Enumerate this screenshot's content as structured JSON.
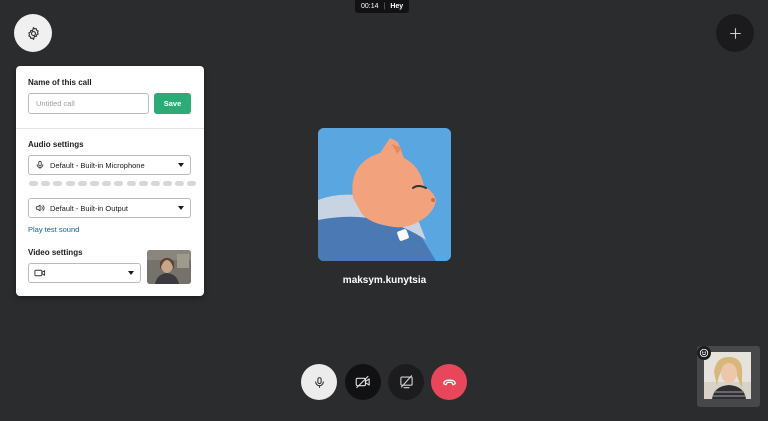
{
  "status": {
    "timer": "00:14",
    "separator": "|",
    "participant_label": "Hey"
  },
  "icons": {
    "settings": "gear-icon",
    "add": "plus-icon",
    "mic": "microphone-icon",
    "speaker": "speaker-icon",
    "camera": "camera-icon",
    "video_off": "video-off-icon",
    "screen_share_off": "screen-share-off-icon",
    "hangup": "phone-hangup-icon",
    "emoji": "smiley-icon"
  },
  "settings_panel": {
    "call_name": {
      "label": "Name of this call",
      "placeholder": "Untitled call",
      "value": "",
      "save_label": "Save"
    },
    "audio": {
      "label": "Audio settings",
      "microphone_selected": "Default - Built-in Microphone",
      "output_selected": "Default - Built-in Output",
      "level_segments": 14,
      "test_sound_label": "Play test sound"
    },
    "video": {
      "label": "Video settings",
      "camera_selected": ""
    }
  },
  "participant": {
    "name": "maksym.kunytsia"
  },
  "colors": {
    "background": "#2b2c2e",
    "save_green": "#2bac76",
    "link_blue": "#1264a3",
    "hangup_red": "#e8475b",
    "avatar_blue": "#5aa6e0"
  }
}
